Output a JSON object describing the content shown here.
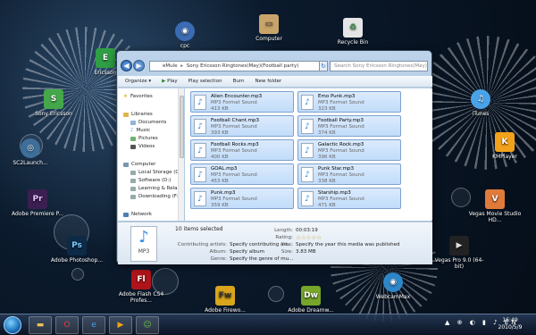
{
  "desktop": {
    "icons": [
      {
        "label": "cpc",
        "icon": "cpc-icon",
        "color": "#3b6bb3",
        "glyph": "◉"
      },
      {
        "label": "Computer",
        "icon": "computer-icon",
        "color": "#c9a46a",
        "glyph": "▭"
      },
      {
        "label": "Recycle Bin",
        "icon": "recycle-bin-icon",
        "color": "#e5e5e5",
        "glyph": "♻"
      },
      {
        "label": "Ericsson",
        "icon": "ericsson-icon",
        "color": "#2f9e44",
        "glyph": "E"
      },
      {
        "label": "Sony Ericsson",
        "icon": "sony-ericsson-icon",
        "color": "#44a84a",
        "glyph": "S"
      },
      {
        "label": "iTunes",
        "icon": "itunes-icon",
        "color": "#4aa3e8",
        "glyph": "♫"
      },
      {
        "label": "SC2Launch...",
        "icon": "sc2-icon",
        "color": "#3d6f9a",
        "glyph": "◎"
      },
      {
        "label": "KMPlayer",
        "icon": "kmplayer-icon",
        "color": "#f2a21a",
        "glyph": "K"
      },
      {
        "label": "Adobe Premiere P...",
        "icon": "premiere-icon",
        "color": "#3b1f52",
        "glyph": "Pr"
      },
      {
        "label": "Vegas Movie Studio HD...",
        "icon": "vegas-movie-icon",
        "color": "#e07a3a",
        "glyph": "V"
      },
      {
        "label": "Adobe Photoshop...",
        "icon": "photoshop-icon",
        "color": "#0d2a47",
        "glyph": "Ps"
      },
      {
        "label": "Vegas Pro 9.0 (64-bit)",
        "icon": "vegas-pro-icon",
        "color": "#222",
        "glyph": "▶"
      },
      {
        "label": "Adobe Flash CS4 Profes...",
        "icon": "flash-icon",
        "color": "#b0141a",
        "glyph": "Fl"
      },
      {
        "label": "Adobe Firewo...",
        "icon": "fireworks-icon",
        "color": "#d8a51b",
        "glyph": "Fw"
      },
      {
        "label": "Adobe Dreamw...",
        "icon": "dreamweaver-icon",
        "color": "#76a52a",
        "glyph": "Dw"
      },
      {
        "label": "WebcamMax",
        "icon": "webcammax-icon",
        "color": "#2e87c9",
        "glyph": "◉"
      }
    ]
  },
  "window": {
    "breadcrumb": [
      "eMule",
      "Sony Ericsson Ringtones(May)(Football party)"
    ],
    "search_placeholder": "Search Sony Ericsson Ringtones(May)(Fo...",
    "toolbar": [
      "Organize ▾",
      "Play",
      "Play selection",
      "Burn",
      "New folder"
    ],
    "nav": {
      "favorites": "Favorites",
      "libraries": "Libraries",
      "lib_items": [
        "Documents",
        "Music",
        "Pictures",
        "Videos"
      ],
      "computer": "Computer",
      "drives": [
        "Local Storage (C:)",
        "Software (D:)",
        "Learning & Relax",
        "Downloading (F:)"
      ],
      "network": "Network"
    },
    "files": [
      {
        "name": "Alien Encounter.mp3",
        "type": "MP3 Format Sound",
        "size": "413 KB"
      },
      {
        "name": "Emo Punk.mp3",
        "type": "MP3 Format Sound",
        "size": "323 KB"
      },
      {
        "name": "Football Chant.mp3",
        "type": "MP3 Format Sound",
        "size": "393 KB"
      },
      {
        "name": "Football Party.mp3",
        "type": "MP3 Format Sound",
        "size": "374 KB"
      },
      {
        "name": "Football Rocks.mp3",
        "type": "MP3 Format Sound",
        "size": "400 KB"
      },
      {
        "name": "Galactic Rock.mp3",
        "type": "MP3 Format Sound",
        "size": "396 KB"
      },
      {
        "name": "GOAL.mp3",
        "type": "MP3 Format Sound",
        "size": "453 KB"
      },
      {
        "name": "Punk Star.mp3",
        "type": "MP3 Format Sound",
        "size": "338 KB"
      },
      {
        "name": "Punk.mp3",
        "type": "MP3 Format Sound",
        "size": "359 KB"
      },
      {
        "name": "Starship.mp3",
        "type": "MP3 Format Sound",
        "size": "471 KB"
      }
    ],
    "details": {
      "selected": "10 items selected",
      "thumb_label": "MP3",
      "contributing_label": "Contributing artists:",
      "contributing_value": "Specify contributing art...",
      "album_label": "Album:",
      "album_value": "Specify album",
      "genre_label": "Genre:",
      "genre_value": "Specify the genre of mu...",
      "length_label": "Length:",
      "length_value": "00:03:19",
      "rating_label": "Rating:",
      "rating_value": "☆☆☆☆☆",
      "year_label": "Year:",
      "year_value": "Specify the year this media was published",
      "size_label": "Size:",
      "size_value": "3.83 MB"
    }
  },
  "taskbar": {
    "clock_time": "16:49",
    "clock_date": "2010/5/9",
    "tray": "▲ ⊕ ◐ ▮ ♪ EN"
  }
}
